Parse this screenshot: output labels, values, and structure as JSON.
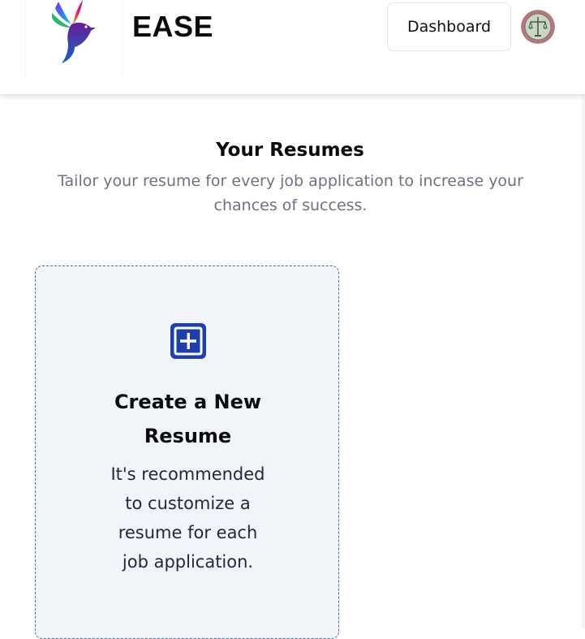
{
  "header": {
    "brand": "EASE",
    "logo_icon": "hummingbird-logo-icon",
    "dashboard_label": "Dashboard",
    "avatar_icon": "user-avatar-icon"
  },
  "main": {
    "title": "Your Resumes",
    "subtitle": "Tailor your resume for every job application to increase your chances of success."
  },
  "create_card": {
    "icon": "plus-square-icon",
    "title_lines": [
      "Create a New",
      "Resume"
    ],
    "description_lines": [
      "It's recommended",
      "to customize a",
      "resume for each",
      "job application."
    ]
  },
  "colors": {
    "accent": "#1e3fae",
    "card_bg": "#f1f4f8",
    "card_border": "#4f6f9a",
    "subtitle": "#6b7280"
  }
}
